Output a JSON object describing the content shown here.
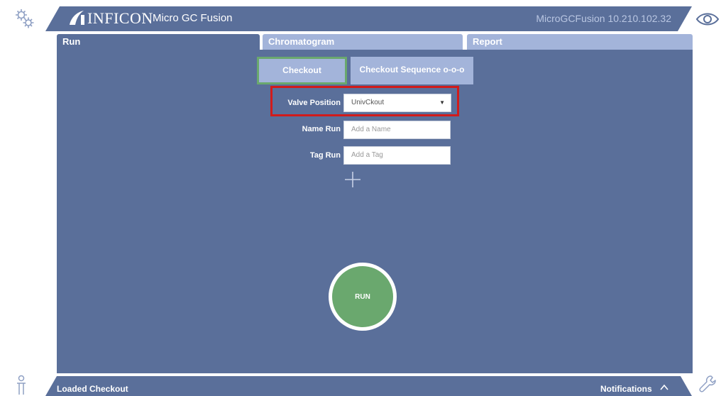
{
  "header": {
    "brand": "INFICON",
    "product": "Micro GC Fusion",
    "device": "MicroGCFusion 10.210.102.32"
  },
  "icons": {
    "top_left": "gear-icon",
    "top_right": "eye-icon",
    "bottom_left": "person-icon",
    "bottom_right": "wrench-icon",
    "add": "plus-icon",
    "notifications": "chevron-up-icon"
  },
  "tabs": [
    {
      "label": "Run"
    },
    {
      "label": "Chromatogram"
    },
    {
      "label": "Report"
    }
  ],
  "buttons": {
    "checkout": "Checkout",
    "checkout_sequence": "Checkout Sequence o-o-o",
    "run": "RUN"
  },
  "form": {
    "valve_label": "Valve Position",
    "valve_value": "UnivCkout",
    "name_label": "Name Run",
    "name_placeholder": "Add a Name",
    "tag_label": "Tag Run",
    "tag_placeholder": "Add a Tag"
  },
  "footer": {
    "status": "Loaded Checkout",
    "notifications": "Notifications"
  },
  "colors": {
    "primary": "#5a6f9a",
    "tab_inactive": "#a3b4da",
    "run_green": "#6aa86e",
    "highlight_red": "#d11b1b"
  }
}
